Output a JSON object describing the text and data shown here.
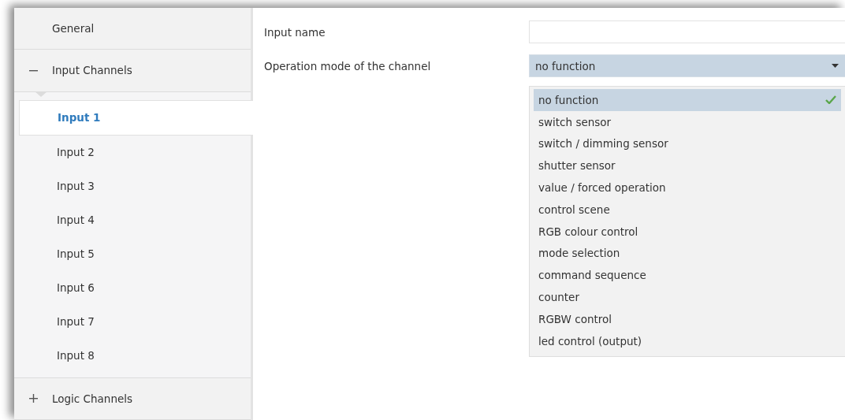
{
  "sidebar": {
    "items": [
      {
        "label": "General",
        "kind": "leaf",
        "selected": false
      },
      {
        "label": "Input Channels",
        "kind": "group",
        "expanded": true,
        "selected": false,
        "children": [
          {
            "label": "Input 1",
            "selected": true
          },
          {
            "label": "Input 2",
            "selected": false
          },
          {
            "label": "Input 3",
            "selected": false
          },
          {
            "label": "Input 4",
            "selected": false
          },
          {
            "label": "Input 5",
            "selected": false
          },
          {
            "label": "Input 6",
            "selected": false
          },
          {
            "label": "Input 7",
            "selected": false
          },
          {
            "label": "Input 8",
            "selected": false
          }
        ]
      },
      {
        "label": "Logic Channels",
        "kind": "group",
        "expanded": false,
        "selected": false
      }
    ]
  },
  "form": {
    "fields": [
      {
        "label": "Input name",
        "kind": "text"
      },
      {
        "label": "Operation mode of the channel",
        "kind": "dropdown",
        "value": "no function",
        "options": [
          {
            "label": "no function",
            "selected": true
          },
          {
            "label": "switch sensor",
            "selected": false
          },
          {
            "label": "switch / dimming sensor",
            "selected": false
          },
          {
            "label": "shutter sensor",
            "selected": false
          },
          {
            "label": "value / forced operation",
            "selected": false
          },
          {
            "label": "control scene",
            "selected": false
          },
          {
            "label": "RGB colour control",
            "selected": false
          },
          {
            "label": "mode selection",
            "selected": false
          },
          {
            "label": "command sequence",
            "selected": false
          },
          {
            "label": "counter",
            "selected": false
          },
          {
            "label": "RGBW control",
            "selected": false
          },
          {
            "label": "led control (output)",
            "selected": false
          }
        ]
      }
    ]
  }
}
